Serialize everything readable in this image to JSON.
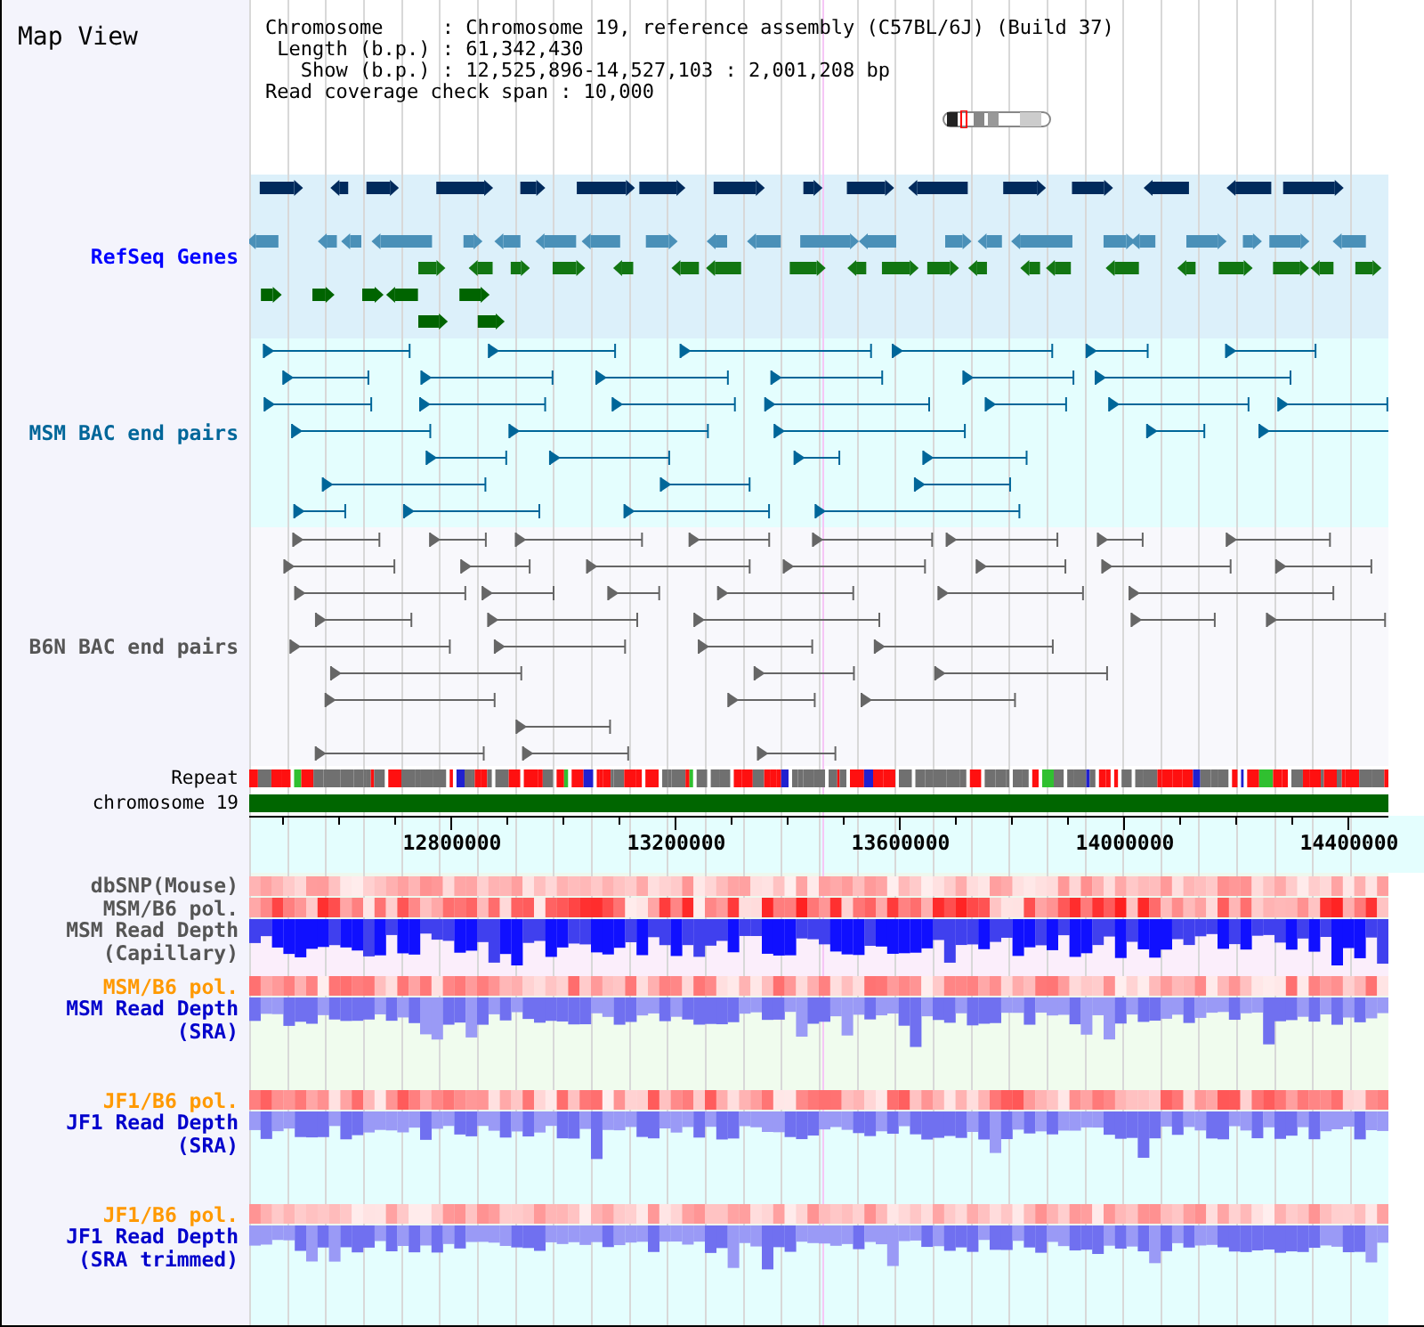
{
  "title": "Map View",
  "header": [
    "Chromosome     : Chromosome 19, reference assembly (C57BL/6J) (Build 37)",
    " Length (b.p.) : 61,342,430",
    "   Show (b.p.) : 12,525,896-14,527,103 : 2,001,208 bp",
    "Read coverage check span : 10,000"
  ],
  "tracks": [
    {
      "kind": "genes",
      "label": "RefSeq Genes",
      "color": "#0000ff"
    },
    {
      "kind": "bac",
      "label": "MSM BAC end pairs",
      "color": "#006699"
    },
    {
      "kind": "bac",
      "label": "B6N BAC end pairs",
      "color": "#555555"
    },
    {
      "kind": "repeat",
      "label": "Repeat"
    },
    {
      "kind": "chromosome",
      "label": "chromosome 19"
    },
    {
      "kind": "axis",
      "ticks": [
        "12800000",
        "13200000",
        "13600000",
        "14000000",
        "14400000"
      ]
    },
    {
      "kind": "heat",
      "label": "dbSNP(Mouse)",
      "color": "#555555"
    },
    {
      "kind": "heat",
      "label": "MSM/B6 pol.",
      "color": "#555555"
    },
    {
      "kind": "capillary",
      "label": "MSM Read Depth\n(Capillary)",
      "color": "#555555"
    },
    {
      "kind": "heat",
      "label": "MSM/B6 pol.",
      "color": "#ff9900"
    },
    {
      "kind": "depth",
      "label": "MSM Read Depth\n(SRA)",
      "color": "#0000cc"
    },
    {
      "kind": "heat",
      "label": "JF1/B6 pol.",
      "color": "#ff9900"
    },
    {
      "kind": "depth",
      "label": "JF1 Read Depth\n(SRA)",
      "color": "#0000cc"
    },
    {
      "kind": "heat",
      "label": "JF1/B6 pol.",
      "color": "#ff9900"
    },
    {
      "kind": "depth",
      "label": "JF1 Read Depth\n(SRA trimmed)",
      "color": "#0000cc"
    }
  ]
}
